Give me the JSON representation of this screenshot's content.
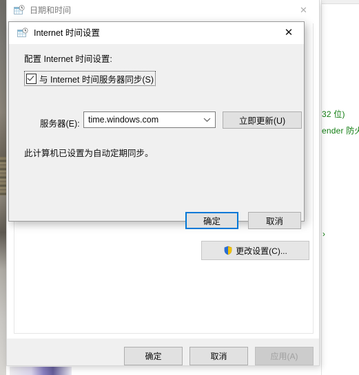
{
  "outer_window": {
    "title": "日期和时间",
    "icon": "date-time-icon",
    "close_label": "✕",
    "change_settings_label": "更改设置(C)...",
    "change_settings_icon": "shield-icon",
    "footer_buttons": [
      {
        "label": "确定",
        "name": "ok-button",
        "disabled": false
      },
      {
        "label": "取消",
        "name": "cancel-button",
        "disabled": false
      },
      {
        "label": "应用(A)",
        "name": "apply-button",
        "disabled": true
      }
    ]
  },
  "modal": {
    "title": "Internet 时间设置",
    "icon": "date-time-icon",
    "close_label": "✕",
    "configure_label": "配置 Internet 时间设置:",
    "sync_checkbox": {
      "label": "与 Internet 时间服务器同步(S)",
      "checked": true,
      "focused": true
    },
    "server_label": "服务器(E):",
    "server_value": "time.windows.com",
    "server_arrow": "chevron-down-icon",
    "update_now_label": "立即更新(U)",
    "status_text": "此计算机已设置为自动定期同步。",
    "buttons": [
      {
        "label": "确定",
        "name": "modal-ok-button",
        "default": true
      },
      {
        "label": "取消",
        "name": "modal-cancel-button",
        "default": false
      }
    ]
  },
  "background_window": {
    "text_fragment_1": "32 位)",
    "text_fragment_2": "ender 防火墙",
    "chevron": "›",
    "accent_color": "#107c10"
  },
  "colors": {
    "focus_blue": "#0078d7",
    "dialog_face": "#f0f0f0",
    "button_face": "#e1e1e1",
    "green_text": "#107c10"
  }
}
